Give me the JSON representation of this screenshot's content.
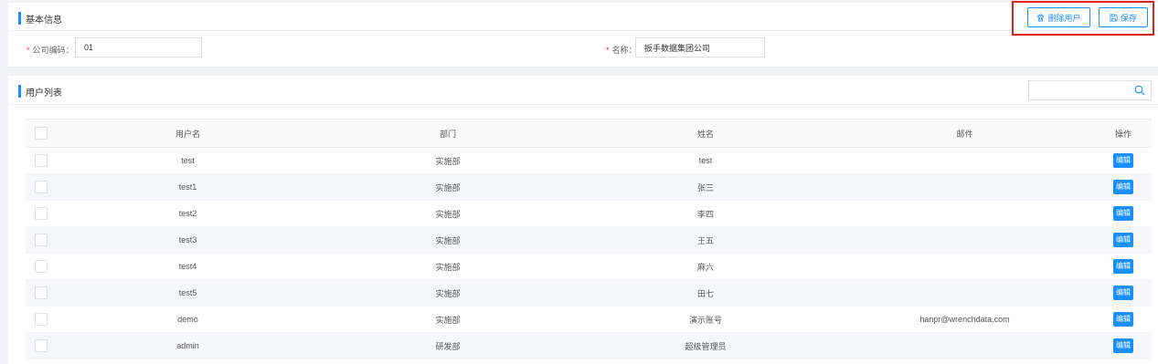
{
  "basic_info": {
    "title": "基本信息",
    "delete_user_label": "删除用户",
    "save_label": "保存",
    "company_code_label": "公司编码：",
    "company_code_value": "01",
    "name_label": "名称：",
    "name_value": "扳手数据集团公司",
    "required_mark": "*"
  },
  "user_list": {
    "title": "用户列表",
    "search_placeholder": "",
    "columns": [
      "用户名",
      "部门",
      "姓名",
      "邮件",
      "操作"
    ],
    "rows": [
      {
        "username": "test",
        "dept": "实施部",
        "name": "test",
        "email": "",
        "action": "编辑"
      },
      {
        "username": "test1",
        "dept": "实施部",
        "name": "张三",
        "email": "",
        "action": "编辑"
      },
      {
        "username": "test2",
        "dept": "实施部",
        "name": "李四",
        "email": "",
        "action": "编辑"
      },
      {
        "username": "test3",
        "dept": "实施部",
        "name": "王五",
        "email": "",
        "action": "编辑"
      },
      {
        "username": "test4",
        "dept": "实施部",
        "name": "麻六",
        "email": "",
        "action": "编辑"
      },
      {
        "username": "test5",
        "dept": "实施部",
        "name": "田七",
        "email": "",
        "action": "编辑"
      },
      {
        "username": "demo",
        "dept": "实施部",
        "name": "演示账号",
        "email": "hanpr@wrenchdata.com",
        "action": "编辑"
      },
      {
        "username": "admin",
        "dept": "研发部",
        "name": "超级管理员",
        "email": "",
        "action": "编辑"
      }
    ]
  },
  "colors": {
    "accent": "#1890ff",
    "highlight": "#e81e1e",
    "required": "#f5222d"
  },
  "icons": {
    "delete": "trash-icon",
    "save": "save-icon",
    "search": "search-icon"
  }
}
